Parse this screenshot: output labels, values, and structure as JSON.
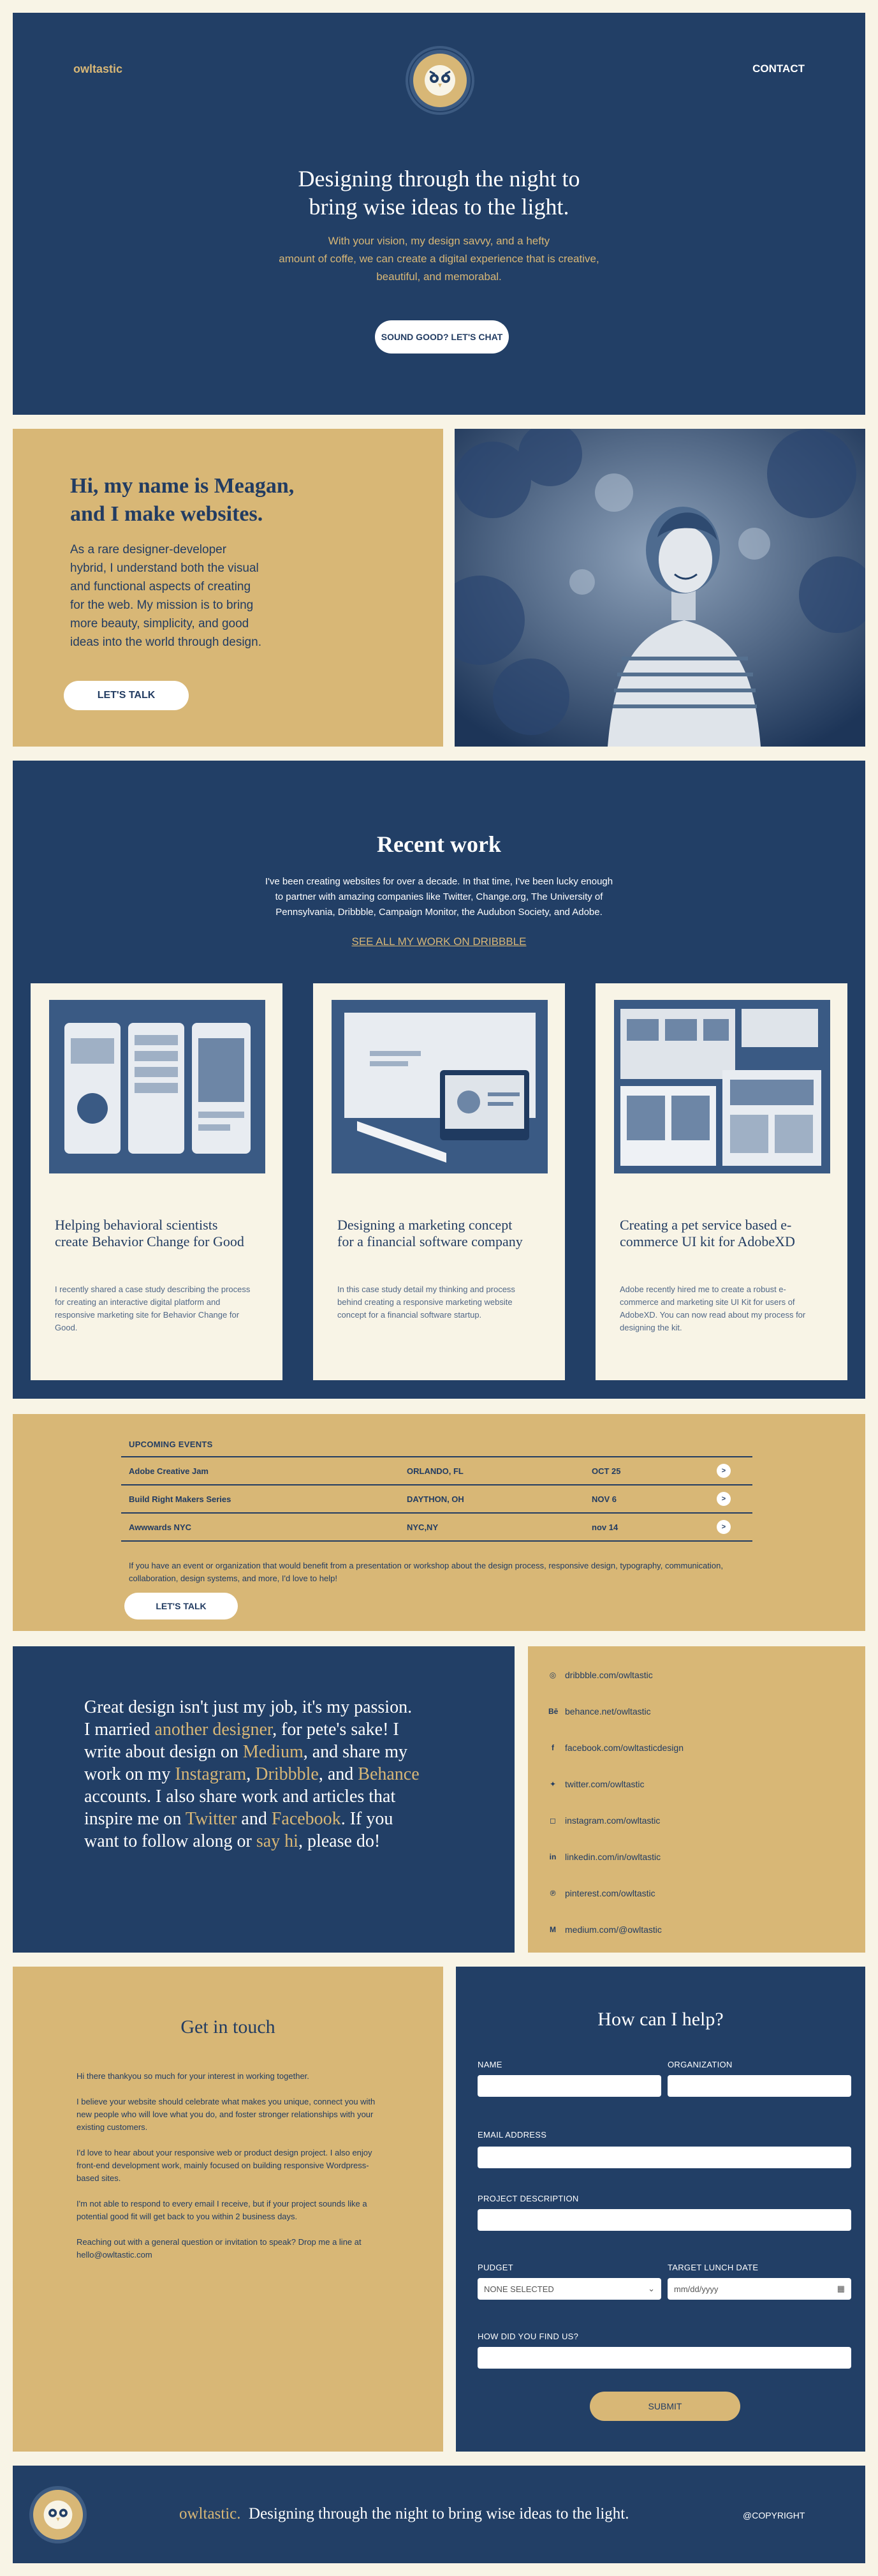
{
  "header": {
    "brand": "owltastic",
    "contact_label": "CONTACT",
    "headline_line1": "Designing through the night to",
    "headline_line2": "bring wise ideas to the light.",
    "sub_line1": "With your vision, my design savvy, and a hefty",
    "sub_line2": "amount of coffe, we can create a digital experience that is creative,",
    "sub_line3": "beautiful, and memorabal.",
    "cta_label": "SOUND GOOD? LET'S CHAT"
  },
  "about": {
    "title_line1": "Hi, my name is Meagan,",
    "title_line2": "and I make websites.",
    "body": "As a rare designer-developer hybrid, I understand both the visual and functional aspects of creating for the web. My mission is to bring more beauty, simplicity, and good ideas into the world through design.",
    "button_label": "LET'S TALK"
  },
  "work": {
    "title": "Recent work",
    "intro_line1": "I've been creating websites for over a decade. In that time, I've been lucky enough",
    "intro_line2": "to partner with amazing companies like Twitter, Change.org, The University of",
    "intro_line3": "Pennsylvania, Dribbble, Campaign Monitor, the Audubon Society, and Adobe.",
    "see_all": "SEE ALL MY WORK ON DRIBBBLE",
    "cards": [
      {
        "title": "Helping behavioral scientists create Behavior Change for Good",
        "body": "I recently shared a case study describing the process for creating an interactive digital platform and responsive marketing site for Behavior Change for Good."
      },
      {
        "title": "Designing a marketing concept for a financial software company",
        "body": "In this case study detail my thinking and process behind creating a responsive marketing website concept for a financial software startup."
      },
      {
        "title": "Creating a pet service based e-commerce UI kit for AdobeXD",
        "body": "Adobe recently hired me to create a robust e-commerce and marketing site UI Kit for users of AdobeXD. You can now read about my process for designing the kit."
      }
    ]
  },
  "events": {
    "title": "UPCOMING EVENTS",
    "rows": [
      {
        "name": "Adobe Creative Jam",
        "place": "ORLANDO, FL",
        "date": "OCT 25"
      },
      {
        "name": "Build Right Makers Series",
        "place": "DAYTHON, OH",
        "date": "NOV 6"
      },
      {
        "name": "Awwwards NYC",
        "place": "NYC,NY",
        "date": "nov 14"
      }
    ],
    "note": "If you have an event or organization that would benefit from a presentation or workshop about the design process, responsive design, typography, communication, collaboration, design systems, and more, I'd love to help!",
    "button_label": "LET'S TALK"
  },
  "quote": {
    "t1": "Great design isn't just my job, it's my passion. I married ",
    "l1": "another designer",
    "t2": ", for pete's sake! I write about design on ",
    "l2": "Medium",
    "t3": ", and share my work on my ",
    "l3": "Instagram",
    "t4": ", ",
    "l4": "Dribbble",
    "t5": ", and ",
    "l5": "Behance",
    "t6": " accounts. I also share work and articles that inspire me on ",
    "l6": "Twitter",
    "t7": " and ",
    "l7": "Facebook",
    "t8": ". If you want to follow along or ",
    "l8": "say hi",
    "t9": ", please do!"
  },
  "social": [
    {
      "icon": "dribbble-icon",
      "glyph": "◎",
      "label": "dribbble.com/owltastic"
    },
    {
      "icon": "behance-icon",
      "glyph": "Bē",
      "label": "behance.net/owltastic"
    },
    {
      "icon": "facebook-icon",
      "glyph": "f",
      "label": "facebook.com/owltasticdesign"
    },
    {
      "icon": "twitter-icon",
      "glyph": "✦",
      "label": "twitter.com/owltastic"
    },
    {
      "icon": "instagram-icon",
      "glyph": "◻",
      "label": "instagram.com/owltastic"
    },
    {
      "icon": "linkedin-icon",
      "glyph": "in",
      "label": "linkedin.com/in/owltastic"
    },
    {
      "icon": "pinterest-icon",
      "glyph": "℗",
      "label": "pinterest.com/owltastic"
    },
    {
      "icon": "medium-icon",
      "glyph": "M",
      "label": "medium.com/@owltastic"
    }
  ],
  "contact": {
    "title": "Get in touch",
    "paragraphs": [
      "Hi there thankyou so much for your interest in working together.",
      "I believe your website should celebrate what makes you unique, connect you with new people who will love what you do, and foster stronger relationships with your existing customers.",
      "I'd love to hear about your responsive web or product design project. I also enjoy front-end development work, mainly focused on building responsive Wordpress-based sites.",
      "I'm not able to respond to every email I receive, but if your project sounds like a potential good fit will get back to you within 2 business days.",
      "Reaching out with a general question or invitation to speak? Drop me a line at hello@owltastic.com"
    ]
  },
  "form": {
    "title": "How can I help?",
    "name_label": "NAME",
    "org_label": "ORGANIZATION",
    "email_label": "EMAIL ADDRESS",
    "desc_label": "PROJECT DESCRIPTION",
    "budget_label": "PUDGET",
    "budget_value": "NONE SELECTED",
    "date_label": "TARGET LUNCH DATE",
    "date_placeholder": "mm/dd/yyyy",
    "find_label": "HOW DID YOU FIND US?",
    "submit_label": "SUBMIT"
  },
  "footer": {
    "brand": "owltastic.",
    "tagline": "Designing through the night to bring wise ideas to the light.",
    "copyright": "@COPYRIGHT"
  }
}
